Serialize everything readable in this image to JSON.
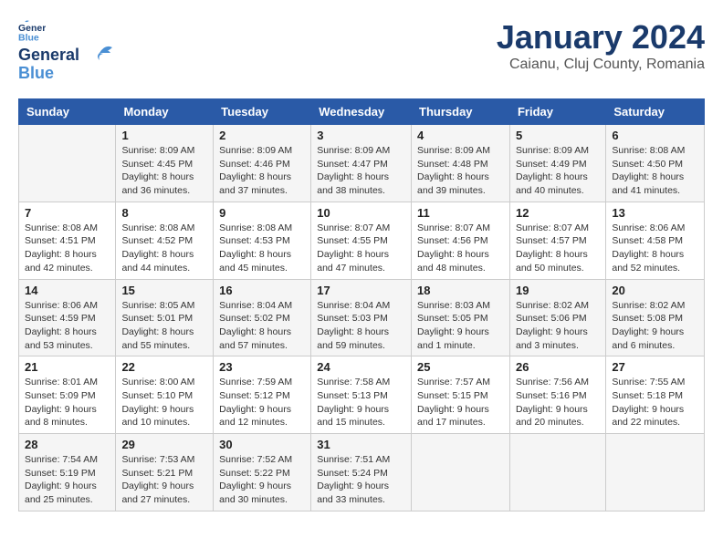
{
  "header": {
    "logo": {
      "general": "General",
      "blue": "Blue"
    },
    "title": "January 2024",
    "subtitle": "Caianu, Cluj County, Romania"
  },
  "columns": [
    "Sunday",
    "Monday",
    "Tuesday",
    "Wednesday",
    "Thursday",
    "Friday",
    "Saturday"
  ],
  "weeks": [
    [
      {
        "day": "",
        "sunrise": "",
        "sunset": "",
        "daylight": ""
      },
      {
        "day": "1",
        "sunrise": "Sunrise: 8:09 AM",
        "sunset": "Sunset: 4:45 PM",
        "daylight": "Daylight: 8 hours and 36 minutes."
      },
      {
        "day": "2",
        "sunrise": "Sunrise: 8:09 AM",
        "sunset": "Sunset: 4:46 PM",
        "daylight": "Daylight: 8 hours and 37 minutes."
      },
      {
        "day": "3",
        "sunrise": "Sunrise: 8:09 AM",
        "sunset": "Sunset: 4:47 PM",
        "daylight": "Daylight: 8 hours and 38 minutes."
      },
      {
        "day": "4",
        "sunrise": "Sunrise: 8:09 AM",
        "sunset": "Sunset: 4:48 PM",
        "daylight": "Daylight: 8 hours and 39 minutes."
      },
      {
        "day": "5",
        "sunrise": "Sunrise: 8:09 AM",
        "sunset": "Sunset: 4:49 PM",
        "daylight": "Daylight: 8 hours and 40 minutes."
      },
      {
        "day": "6",
        "sunrise": "Sunrise: 8:08 AM",
        "sunset": "Sunset: 4:50 PM",
        "daylight": "Daylight: 8 hours and 41 minutes."
      }
    ],
    [
      {
        "day": "7",
        "sunrise": "Sunrise: 8:08 AM",
        "sunset": "Sunset: 4:51 PM",
        "daylight": "Daylight: 8 hours and 42 minutes."
      },
      {
        "day": "8",
        "sunrise": "Sunrise: 8:08 AM",
        "sunset": "Sunset: 4:52 PM",
        "daylight": "Daylight: 8 hours and 44 minutes."
      },
      {
        "day": "9",
        "sunrise": "Sunrise: 8:08 AM",
        "sunset": "Sunset: 4:53 PM",
        "daylight": "Daylight: 8 hours and 45 minutes."
      },
      {
        "day": "10",
        "sunrise": "Sunrise: 8:07 AM",
        "sunset": "Sunset: 4:55 PM",
        "daylight": "Daylight: 8 hours and 47 minutes."
      },
      {
        "day": "11",
        "sunrise": "Sunrise: 8:07 AM",
        "sunset": "Sunset: 4:56 PM",
        "daylight": "Daylight: 8 hours and 48 minutes."
      },
      {
        "day": "12",
        "sunrise": "Sunrise: 8:07 AM",
        "sunset": "Sunset: 4:57 PM",
        "daylight": "Daylight: 8 hours and 50 minutes."
      },
      {
        "day": "13",
        "sunrise": "Sunrise: 8:06 AM",
        "sunset": "Sunset: 4:58 PM",
        "daylight": "Daylight: 8 hours and 52 minutes."
      }
    ],
    [
      {
        "day": "14",
        "sunrise": "Sunrise: 8:06 AM",
        "sunset": "Sunset: 4:59 PM",
        "daylight": "Daylight: 8 hours and 53 minutes."
      },
      {
        "day": "15",
        "sunrise": "Sunrise: 8:05 AM",
        "sunset": "Sunset: 5:01 PM",
        "daylight": "Daylight: 8 hours and 55 minutes."
      },
      {
        "day": "16",
        "sunrise": "Sunrise: 8:04 AM",
        "sunset": "Sunset: 5:02 PM",
        "daylight": "Daylight: 8 hours and 57 minutes."
      },
      {
        "day": "17",
        "sunrise": "Sunrise: 8:04 AM",
        "sunset": "Sunset: 5:03 PM",
        "daylight": "Daylight: 8 hours and 59 minutes."
      },
      {
        "day": "18",
        "sunrise": "Sunrise: 8:03 AM",
        "sunset": "Sunset: 5:05 PM",
        "daylight": "Daylight: 9 hours and 1 minute."
      },
      {
        "day": "19",
        "sunrise": "Sunrise: 8:02 AM",
        "sunset": "Sunset: 5:06 PM",
        "daylight": "Daylight: 9 hours and 3 minutes."
      },
      {
        "day": "20",
        "sunrise": "Sunrise: 8:02 AM",
        "sunset": "Sunset: 5:08 PM",
        "daylight": "Daylight: 9 hours and 6 minutes."
      }
    ],
    [
      {
        "day": "21",
        "sunrise": "Sunrise: 8:01 AM",
        "sunset": "Sunset: 5:09 PM",
        "daylight": "Daylight: 9 hours and 8 minutes."
      },
      {
        "day": "22",
        "sunrise": "Sunrise: 8:00 AM",
        "sunset": "Sunset: 5:10 PM",
        "daylight": "Daylight: 9 hours and 10 minutes."
      },
      {
        "day": "23",
        "sunrise": "Sunrise: 7:59 AM",
        "sunset": "Sunset: 5:12 PM",
        "daylight": "Daylight: 9 hours and 12 minutes."
      },
      {
        "day": "24",
        "sunrise": "Sunrise: 7:58 AM",
        "sunset": "Sunset: 5:13 PM",
        "daylight": "Daylight: 9 hours and 15 minutes."
      },
      {
        "day": "25",
        "sunrise": "Sunrise: 7:57 AM",
        "sunset": "Sunset: 5:15 PM",
        "daylight": "Daylight: 9 hours and 17 minutes."
      },
      {
        "day": "26",
        "sunrise": "Sunrise: 7:56 AM",
        "sunset": "Sunset: 5:16 PM",
        "daylight": "Daylight: 9 hours and 20 minutes."
      },
      {
        "day": "27",
        "sunrise": "Sunrise: 7:55 AM",
        "sunset": "Sunset: 5:18 PM",
        "daylight": "Daylight: 9 hours and 22 minutes."
      }
    ],
    [
      {
        "day": "28",
        "sunrise": "Sunrise: 7:54 AM",
        "sunset": "Sunset: 5:19 PM",
        "daylight": "Daylight: 9 hours and 25 minutes."
      },
      {
        "day": "29",
        "sunrise": "Sunrise: 7:53 AM",
        "sunset": "Sunset: 5:21 PM",
        "daylight": "Daylight: 9 hours and 27 minutes."
      },
      {
        "day": "30",
        "sunrise": "Sunrise: 7:52 AM",
        "sunset": "Sunset: 5:22 PM",
        "daylight": "Daylight: 9 hours and 30 minutes."
      },
      {
        "day": "31",
        "sunrise": "Sunrise: 7:51 AM",
        "sunset": "Sunset: 5:24 PM",
        "daylight": "Daylight: 9 hours and 33 minutes."
      },
      {
        "day": "",
        "sunrise": "",
        "sunset": "",
        "daylight": ""
      },
      {
        "day": "",
        "sunrise": "",
        "sunset": "",
        "daylight": ""
      },
      {
        "day": "",
        "sunrise": "",
        "sunset": "",
        "daylight": ""
      }
    ]
  ]
}
